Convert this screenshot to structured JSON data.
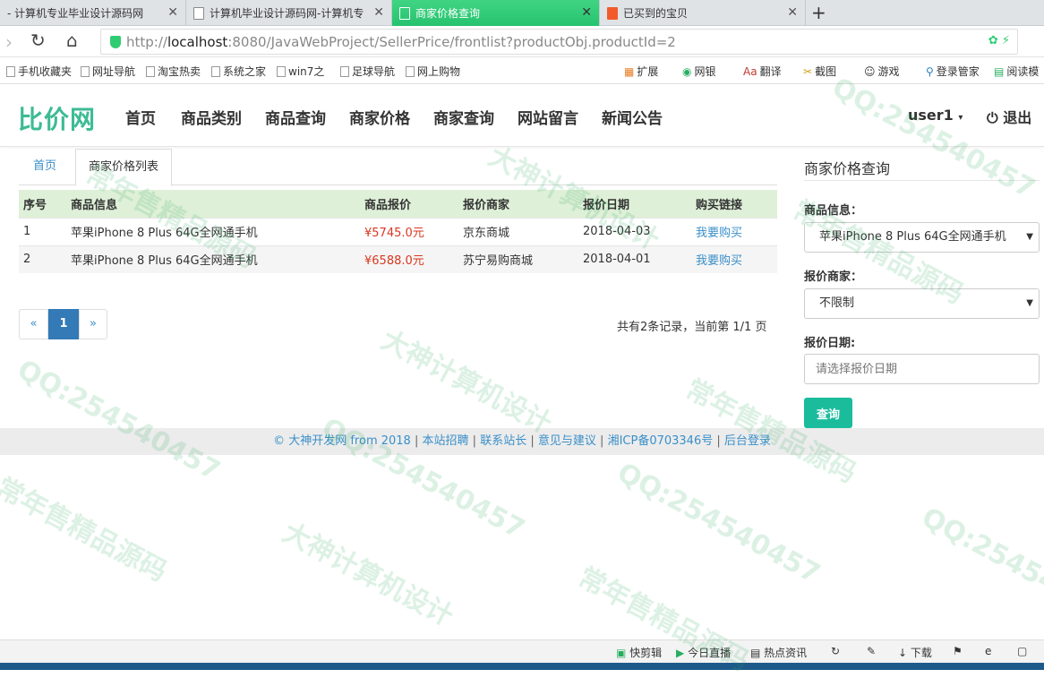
{
  "browser": {
    "tabs": [
      {
        "title": "- 计算机专业毕业设计源码网"
      },
      {
        "title": "计算机毕业设计源码网-计算机专"
      },
      {
        "title": "商家价格查询"
      },
      {
        "title": "已买到的宝贝"
      }
    ],
    "url_prefix": "http://",
    "url_host": "localhost",
    "url_rest": ":8080/JavaWebProject/SellerPrice/frontlist?productObj.productId=2",
    "bookmarks": [
      "手机收藏夹",
      "网址导航",
      "淘宝热卖",
      "系统之家",
      "win7之",
      "足球导航",
      "网上购物"
    ],
    "tools": [
      "扩展",
      "网银",
      "翻译",
      "截图",
      "游戏",
      "登录管家",
      "阅读模"
    ]
  },
  "site": {
    "brand": "比价网",
    "menu": [
      "首页",
      "商品类别",
      "商品查询",
      "商家价格",
      "商家查询",
      "网站留言",
      "新闻公告"
    ],
    "user": "user1",
    "logout": "退出"
  },
  "breadcrumb": {
    "home": "首页",
    "current": "商家价格列表"
  },
  "table": {
    "headers": [
      "序号",
      "商品信息",
      "商品报价",
      "报价商家",
      "报价日期",
      "购买链接"
    ],
    "rows": [
      [
        "1",
        "苹果iPhone 8 Plus 64G全网通手机",
        "¥5745.0元",
        "京东商城",
        "2018-04-03",
        "我要购买"
      ],
      [
        "2",
        "苹果iPhone 8 Plus 64G全网通手机",
        "¥6588.0元",
        "苏宁易购商城",
        "2018-04-01",
        "我要购买"
      ]
    ]
  },
  "pager": {
    "prev": "«",
    "current": "1",
    "next": "»",
    "info": "共有2条记录，当前第 1/1 页"
  },
  "query": {
    "title": "商家价格查询",
    "product_label": "商品信息：",
    "product_value": "苹果iPhone 8 Plus 64G全网通手机",
    "seller_label": "报价商家：",
    "seller_value": "不限制",
    "date_label": "报价日期:",
    "date_placeholder": "请选择报价日期",
    "button": "查询"
  },
  "footer": {
    "copyright": "© 大神开发网 from 2018",
    "links": [
      "本站招聘",
      "联系站长",
      "意见与建议",
      "湘ICP备0703346号",
      "后台登录"
    ]
  },
  "statusbar": [
    "快剪辑",
    "今日直播",
    "热点资讯",
    "下载"
  ],
  "watermarks": [
    "QQ:254540457",
    "常年售精品源码",
    "大神计算机设计"
  ],
  "colors": {
    "brand": "#3cbb94",
    "price": "#d9371f",
    "link": "#3a8fc9",
    "button": "#1abc9c",
    "table_header": "#dff0d8",
    "active_tab": "#2ecc71"
  }
}
